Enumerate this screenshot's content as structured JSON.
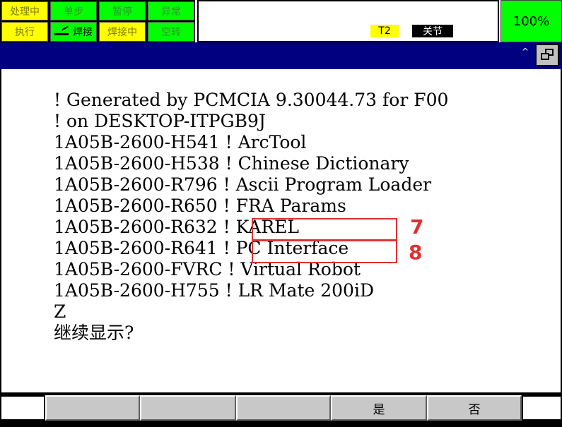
{
  "status": {
    "row1": [
      "处理中",
      "单步",
      "暂停",
      "异常"
    ],
    "row2": [
      "执行",
      "焊接",
      "焊接中",
      "空转"
    ]
  },
  "top_panel": {
    "mode": "T2",
    "state": "关节",
    "override": "100%"
  },
  "title_bar": {
    "caret": "^"
  },
  "content": {
    "lines": [
      "! Generated by PCMCIA 9.30044.73 for F00",
      "! on DESKTOP-ITPGB9J",
      "1A05B-2600-H541 ! ArcTool",
      "1A05B-2600-H538 ! Chinese Dictionary",
      "1A05B-2600-R796 ! Ascii Program Loader",
      "1A05B-2600-R650 ! FRA Params",
      "1A05B-2600-R632 ! KAREL",
      "1A05B-2600-R641 ! PC Interface",
      "1A05B-2600-FVRC ! Virtual Robot",
      "1A05B-2600-H755 ! LR Mate 200iD",
      "Z",
      "继续显示?"
    ]
  },
  "annotations": {
    "labels": [
      "7",
      "8"
    ],
    "color": "#e03030"
  },
  "function_keys": [
    "",
    "",
    "",
    "",
    "是",
    "否"
  ]
}
